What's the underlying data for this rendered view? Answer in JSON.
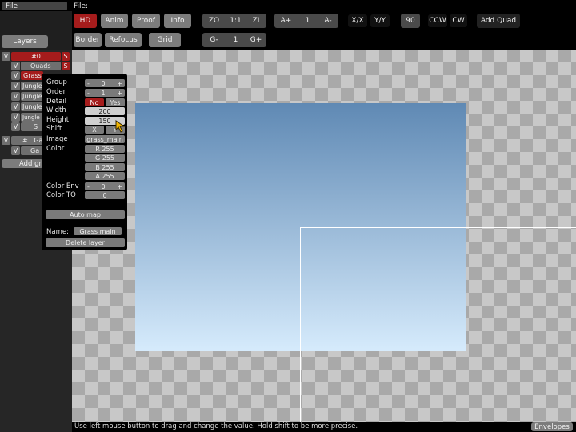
{
  "menu": {
    "file_left": "File",
    "file_right": "File:"
  },
  "toolbar": {
    "row1": [
      {
        "id": "hd",
        "label": "HD",
        "active": true
      },
      {
        "id": "anim",
        "label": "Anim"
      },
      {
        "id": "proof",
        "label": "Proof"
      },
      {
        "id": "info",
        "label": "Info"
      },
      {
        "id": "zoom-out",
        "label": "ZO"
      },
      {
        "id": "zoom-reset",
        "label": "1:1"
      },
      {
        "id": "zoom-in",
        "label": "ZI"
      },
      {
        "id": "anim-speed-up",
        "label": "A+"
      },
      {
        "id": "anim-speed",
        "label": "1"
      },
      {
        "id": "anim-speed-down",
        "label": "A-"
      },
      {
        "id": "flip-x",
        "label": "X/X"
      },
      {
        "id": "flip-y",
        "label": "Y/Y"
      },
      {
        "id": "rotate-angle",
        "label": "90"
      },
      {
        "id": "rotate-ccw",
        "label": "CCW"
      },
      {
        "id": "rotate-cw",
        "label": "CW"
      },
      {
        "id": "add-quad",
        "label": "Add Quad"
      }
    ],
    "row2": [
      {
        "id": "border",
        "label": "Border"
      },
      {
        "id": "refocus",
        "label": "Refocus"
      },
      {
        "id": "grid",
        "label": "Grid"
      },
      {
        "id": "grid-minus",
        "label": "G-"
      },
      {
        "id": "grid-size",
        "label": "1"
      },
      {
        "id": "grid-plus",
        "label": "G+"
      }
    ]
  },
  "layers": {
    "tab_label": "Layers",
    "visible_toggle": "V",
    "group0_name": "#0",
    "group0_short": "S",
    "quads_layer": "Quads",
    "quads_short": "S",
    "grass_layer": "Grass",
    "jungle1": "Jungle",
    "jungle2": "Jungle",
    "jungle3": "Jungle",
    "jungle4": "Jungle",
    "last_item": "S",
    "group1_name": "#1 Ga",
    "group1_child": "Ga",
    "add_group": "Add gr"
  },
  "popup": {
    "group_label": "Group",
    "group_value": "0",
    "order_label": "Order",
    "order_value": "1",
    "detail_label": "Detail",
    "detail_no": "No",
    "detail_yes": "Yes",
    "width_label": "Width",
    "width_value": "200",
    "height_label": "Height",
    "height_value": "150",
    "shift_label": "Shift",
    "shift_x": "X",
    "shift_y": "Y",
    "image_label": "Image",
    "image_value": "grass_main",
    "color_label": "Color",
    "color_r": "R 255",
    "color_g": "G 255",
    "color_b": "B 255",
    "color_a": "A 255",
    "color_env_label": "Color Env",
    "color_env_value": "0",
    "color_to_label": "Color TO",
    "color_to_value": "0",
    "auto_map": "Auto map",
    "name_label": "Name:",
    "name_value": "Grass main",
    "delete_layer": "Delete layer",
    "minus": "-",
    "plus": "+"
  },
  "status": {
    "text": "Use left mouse button to drag and change the value. Hold shift to be more precise.",
    "envelopes": "Envelopes"
  },
  "colors": {
    "active_red": "#a51c1c",
    "button_gray": "#7c7c7c",
    "cursor": "#f0b400"
  }
}
